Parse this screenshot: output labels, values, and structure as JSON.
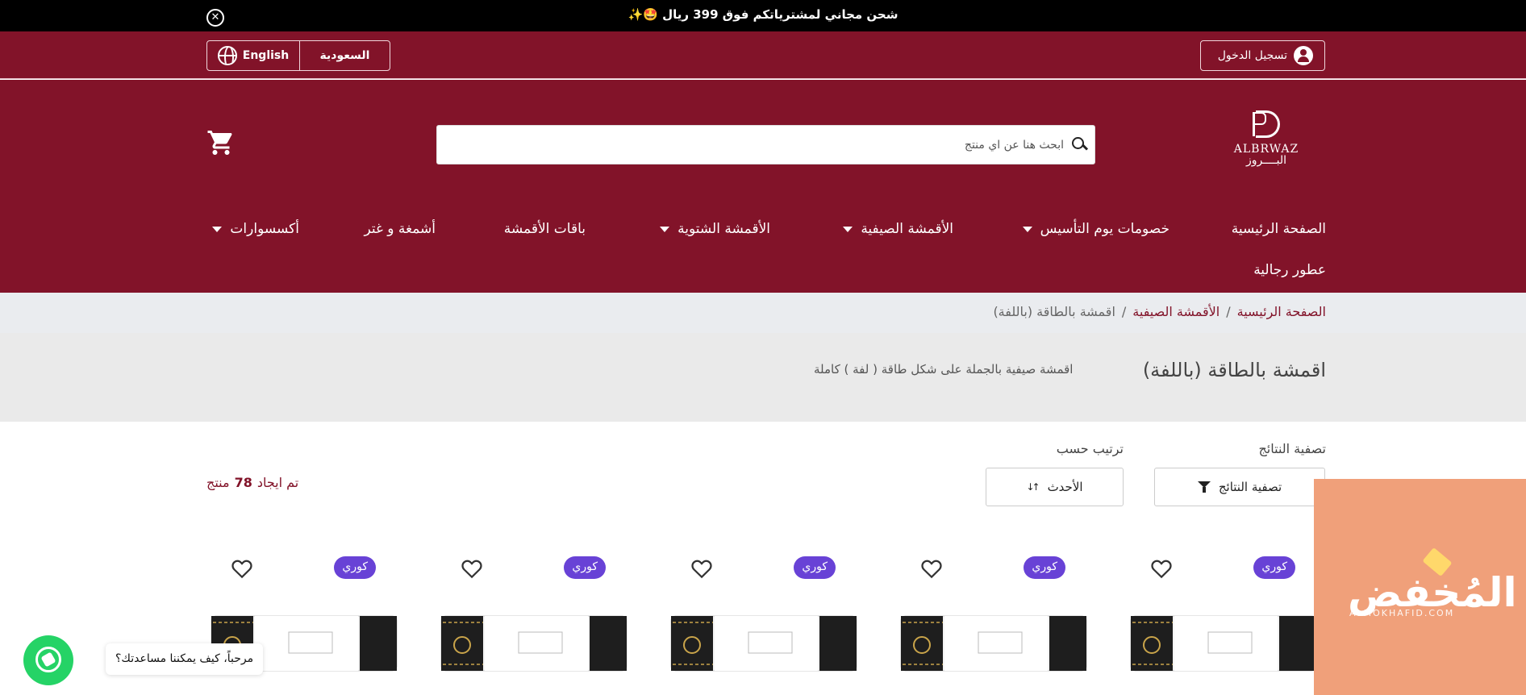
{
  "announcement": {
    "text": "شحن مجاني لمشترياتكم فوق 399 ريال 🤩✨",
    "close_icon": "close-circle-icon"
  },
  "userbar": {
    "login_label": "تسجيل الدخول",
    "language_label": "English",
    "country_label": "السعودية"
  },
  "header": {
    "logo_en": "ALBRWAZ",
    "logo_ar": "البــــروز",
    "search_placeholder": "ابحث هنا عن اي منتج",
    "cart_icon": "shopping-cart-icon"
  },
  "nav": [
    {
      "label": "الصفحة الرئيسية",
      "dropdown": false
    },
    {
      "label": "خصومات يوم التأسيس",
      "dropdown": true
    },
    {
      "label": "الأقمشة الصيفية",
      "dropdown": true
    },
    {
      "label": "الأقمشة الشتوية",
      "dropdown": true
    },
    {
      "label": "باقات الأقمشة",
      "dropdown": false
    },
    {
      "label": "أشمغة و غتر",
      "dropdown": false
    },
    {
      "label": "أكسسوارات",
      "dropdown": true
    },
    {
      "label": "عطور رجالية",
      "dropdown": false
    }
  ],
  "breadcrumb": {
    "home": "الصفحة الرئيسية",
    "parent": "الأقمشة الصيفية",
    "current": "اقمشة بالطاقة (باللفة)",
    "separator": "/"
  },
  "category": {
    "title": "اقمشة بالطاقة (باللفة)",
    "description": "اقمشة صيفية بالجملة على شكل طاقة ( لفة ) كاملة"
  },
  "toolbar": {
    "filter_heading": "تصفية النتائج",
    "filter_button": "تصفية النتائج",
    "sort_heading": "ترتيب حسب",
    "sort_value": "الأحدث",
    "count_prefix": "تم ايجاد",
    "count_value": "78",
    "count_suffix": "منتج"
  },
  "products": [
    {
      "badge": "كوري"
    },
    {
      "badge": "كوري"
    },
    {
      "badge": "كوري"
    },
    {
      "badge": "كوري"
    },
    {
      "badge": "كوري"
    }
  ],
  "watermark": {
    "ar": "المُخفض",
    "en": "ALMOKHAFID.COM"
  },
  "whatsapp": {
    "bubble_text": "مرحباً، كيف يمكننا مساعدتك؟"
  },
  "colors": {
    "brand": "#821329",
    "badge": "#6842d6",
    "whatsapp": "#25d366",
    "watermark": "#f0a07a"
  }
}
